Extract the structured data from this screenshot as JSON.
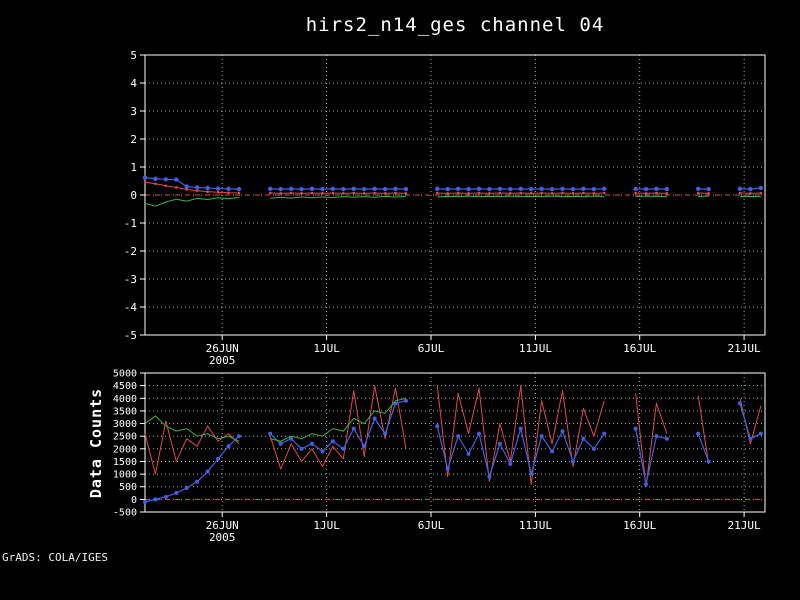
{
  "header": {
    "title": "hirs2_n14_ges channel 04"
  },
  "footer": {
    "watermark": "GrADS: COLA/IGES"
  },
  "colors": {
    "background": "#000000",
    "frame": "#ffffff",
    "grid": "#aaaaaa",
    "blue": "#4060e0",
    "red": "#e04848",
    "green": "#38b438"
  },
  "chart_data": [
    {
      "type": "line",
      "title": "hirs2_n14_ges channel 04",
      "xlabel": "",
      "ylabel": "",
      "xlim": [
        -3.7,
        26.0
      ],
      "ylim": [
        -5,
        5
      ],
      "grid": "dotted",
      "legend": "off",
      "yticks": [
        5,
        4,
        3,
        2,
        1,
        0,
        -1,
        -2,
        -3,
        -4,
        -5
      ],
      "xticks": [
        {
          "x": 0,
          "label": "26JUN",
          "sublabel": "2005"
        },
        {
          "x": 5,
          "label": "1JUL"
        },
        {
          "x": 10,
          "label": "6JUL"
        },
        {
          "x": 15,
          "label": "11JUL"
        },
        {
          "x": 20,
          "label": "16JUL"
        },
        {
          "x": 25,
          "label": "21JUL"
        }
      ],
      "refline": {
        "y": 0,
        "color": "#e04848",
        "dash": "5,5"
      },
      "x_start": -3.7,
      "x_step": 0.5,
      "series": [
        {
          "name": "blue-series",
          "color": "#4060e0",
          "marker": true,
          "marker_size": 2.2,
          "width": 1.2,
          "values": [
            0.62,
            0.58,
            0.56,
            0.55,
            0.3,
            0.27,
            0.25,
            0.23,
            0.22,
            0.21,
            null,
            null,
            0.22,
            0.21,
            0.22,
            0.21,
            0.22,
            0.21,
            0.22,
            0.21,
            0.22,
            0.21,
            0.22,
            0.21,
            0.22,
            0.21,
            null,
            null,
            0.22,
            0.21,
            0.22,
            0.21,
            0.22,
            0.21,
            0.22,
            0.21,
            0.22,
            0.21,
            0.22,
            0.21,
            0.22,
            0.21,
            0.22,
            0.21,
            0.22,
            null,
            null,
            0.22,
            0.21,
            0.22,
            0.21,
            null,
            null,
            0.22,
            0.21,
            null,
            null,
            0.22,
            0.21,
            0.25
          ]
        },
        {
          "name": "red-series",
          "color": "#e04848",
          "marker": true,
          "marker_size": 1.3,
          "width": 1,
          "values": [
            0.46,
            0.4,
            0.33,
            0.27,
            0.2,
            0.15,
            0.12,
            0.1,
            0.08,
            0.07,
            null,
            null,
            0.07,
            0.06,
            0.07,
            0.06,
            0.07,
            0.06,
            0.07,
            0.06,
            0.07,
            0.06,
            0.07,
            0.06,
            0.07,
            0.06,
            null,
            null,
            0.07,
            0.06,
            0.07,
            0.06,
            0.07,
            0.06,
            0.07,
            0.06,
            0.07,
            0.06,
            0.07,
            0.06,
            0.07,
            0.06,
            0.07,
            0.06,
            0.07,
            null,
            null,
            0.07,
            0.06,
            0.07,
            0.06,
            null,
            null,
            0.07,
            0.06,
            null,
            null,
            0.07,
            0.06,
            0.07
          ]
        },
        {
          "name": "green-series",
          "color": "#38b438",
          "marker": false,
          "marker_size": 0,
          "width": 1,
          "values": [
            -0.3,
            -0.4,
            -0.25,
            -0.15,
            -0.22,
            -0.12,
            -0.16,
            -0.1,
            -0.13,
            -0.09,
            null,
            null,
            -0.12,
            -0.08,
            -0.11,
            -0.07,
            -0.1,
            -0.07,
            -0.09,
            -0.06,
            -0.08,
            -0.06,
            -0.08,
            -0.05,
            -0.07,
            -0.05,
            null,
            null,
            -0.07,
            -0.05,
            -0.06,
            -0.04,
            -0.06,
            -0.05,
            -0.06,
            -0.04,
            -0.06,
            -0.05,
            -0.06,
            -0.04,
            -0.06,
            -0.05,
            -0.06,
            -0.04,
            -0.06,
            null,
            null,
            -0.06,
            -0.04,
            -0.06,
            -0.05,
            null,
            null,
            -0.06,
            -0.04,
            null,
            null,
            -0.06,
            -0.05,
            -0.06
          ]
        }
      ]
    },
    {
      "type": "line",
      "title": "",
      "xlabel": "",
      "ylabel": "Data Counts",
      "xlim": [
        -3.7,
        26.0
      ],
      "ylim": [
        -500,
        5000
      ],
      "grid": "dotted",
      "legend": "off",
      "yticks": [
        5000,
        4500,
        4000,
        3500,
        3000,
        2500,
        2000,
        1500,
        1000,
        500,
        0,
        -500
      ],
      "xticks": [
        {
          "x": 0,
          "label": "26JUN",
          "sublabel": "2005"
        },
        {
          "x": 5,
          "label": "1JUL"
        },
        {
          "x": 10,
          "label": "6JUL"
        },
        {
          "x": 15,
          "label": "11JUL"
        },
        {
          "x": 20,
          "label": "16JUL"
        },
        {
          "x": 25,
          "label": "21JUL"
        }
      ],
      "refline": {
        "y": 0,
        "color": "#e04848",
        "dash": "5,5"
      },
      "x_start": -3.7,
      "x_step": 0.5,
      "series": [
        {
          "name": "red-counts",
          "color": "#e04848",
          "marker": false,
          "marker_size": 0,
          "width": 1,
          "values": [
            2600,
            1000,
            3100,
            1500,
            2400,
            2100,
            2900,
            2300,
            2600,
            2200,
            null,
            null,
            2500,
            1200,
            2200,
            1500,
            2000,
            1300,
            2100,
            1600,
            4300,
            1700,
            4500,
            2400,
            4400,
            2000,
            null,
            null,
            4500,
            900,
            4200,
            2600,
            4400,
            700,
            3000,
            1500,
            4500,
            600,
            3900,
            2200,
            4300,
            1300,
            3600,
            2500,
            3900,
            null,
            null,
            4200,
            500,
            3800,
            2600,
            null,
            null,
            4100,
            1400,
            null,
            null,
            4000,
            2200,
            3700
          ]
        },
        {
          "name": "blue-counts",
          "color": "#4060e0",
          "marker": true,
          "marker_size": 2,
          "width": 1.2,
          "values": [
            -100,
            0,
            100,
            250,
            450,
            700,
            1100,
            1600,
            2100,
            2500,
            null,
            null,
            2600,
            2200,
            2400,
            2000,
            2200,
            1900,
            2300,
            2000,
            2800,
            2100,
            3200,
            2600,
            3800,
            3900,
            null,
            null,
            2900,
            1200,
            2500,
            1800,
            2600,
            900,
            2200,
            1400,
            2800,
            1000,
            2500,
            1900,
            2700,
            1500,
            2400,
            2000,
            2600,
            null,
            null,
            2800,
            600,
            2500,
            2400,
            null,
            null,
            2600,
            1500,
            null,
            null,
            3800,
            2400,
            2600
          ]
        },
        {
          "name": "green-counts",
          "color": "#38b438",
          "marker": false,
          "marker_size": 0,
          "width": 1,
          "values": [
            3000,
            3300,
            2900,
            2700,
            2800,
            2500,
            2600,
            2400,
            2500,
            2300,
            null,
            null,
            2400,
            2300,
            2500,
            2400,
            2600,
            2500,
            2800,
            2700,
            3200,
            3000,
            3500,
            3400,
            3900,
            4000,
            null,
            null,
            null,
            null,
            null,
            null,
            null,
            null,
            null,
            null,
            null,
            null,
            null,
            null,
            null,
            null,
            null,
            null,
            null,
            null,
            null,
            null,
            null,
            null,
            null,
            null,
            null,
            null,
            null,
            null,
            null,
            null,
            null,
            null
          ]
        }
      ]
    }
  ]
}
